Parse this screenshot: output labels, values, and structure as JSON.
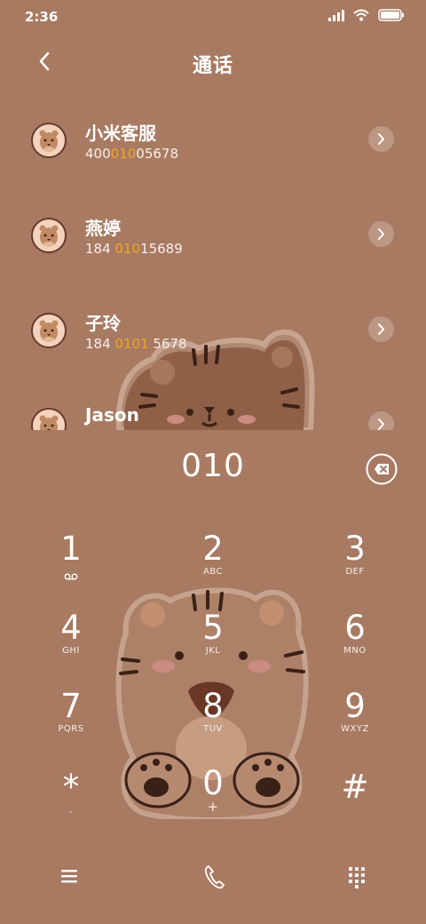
{
  "status_bar": {
    "time": "2:36"
  },
  "header": {
    "title": "通话"
  },
  "contacts": [
    {
      "name": "小米客服",
      "number_parts": [
        "400",
        "010",
        "05678"
      ]
    },
    {
      "name": "燕婷",
      "number_parts": [
        "184 ",
        "010",
        "15689"
      ]
    },
    {
      "name": "子玲",
      "number_parts": [
        "184 ",
        "0101",
        " 5678"
      ]
    },
    {
      "name": "Jason",
      "number_parts": [
        "",
        "",
        ""
      ]
    }
  ],
  "input": {
    "value": "010"
  },
  "keypad": [
    {
      "digit": "1",
      "letters": ""
    },
    {
      "digit": "2",
      "letters": "ABC"
    },
    {
      "digit": "3",
      "letters": "DEF"
    },
    {
      "digit": "4",
      "letters": "GHI"
    },
    {
      "digit": "5",
      "letters": "JKL"
    },
    {
      "digit": "6",
      "letters": "MNO"
    },
    {
      "digit": "7",
      "letters": "PQRS"
    },
    {
      "digit": "8",
      "letters": "TUV"
    },
    {
      "digit": "9",
      "letters": "WXYZ"
    },
    {
      "digit": "*",
      "letters": ","
    },
    {
      "digit": "0",
      "letters": "+"
    },
    {
      "digit": "#",
      "letters": ""
    }
  ],
  "colors": {
    "background": "#a87a62",
    "highlight": "#f0a52a"
  },
  "icons": {
    "back": "chevron-left-icon",
    "backspace": "backspace-icon",
    "menu": "menu-icon",
    "call": "phone-icon",
    "dialpad": "dialpad-icon"
  }
}
